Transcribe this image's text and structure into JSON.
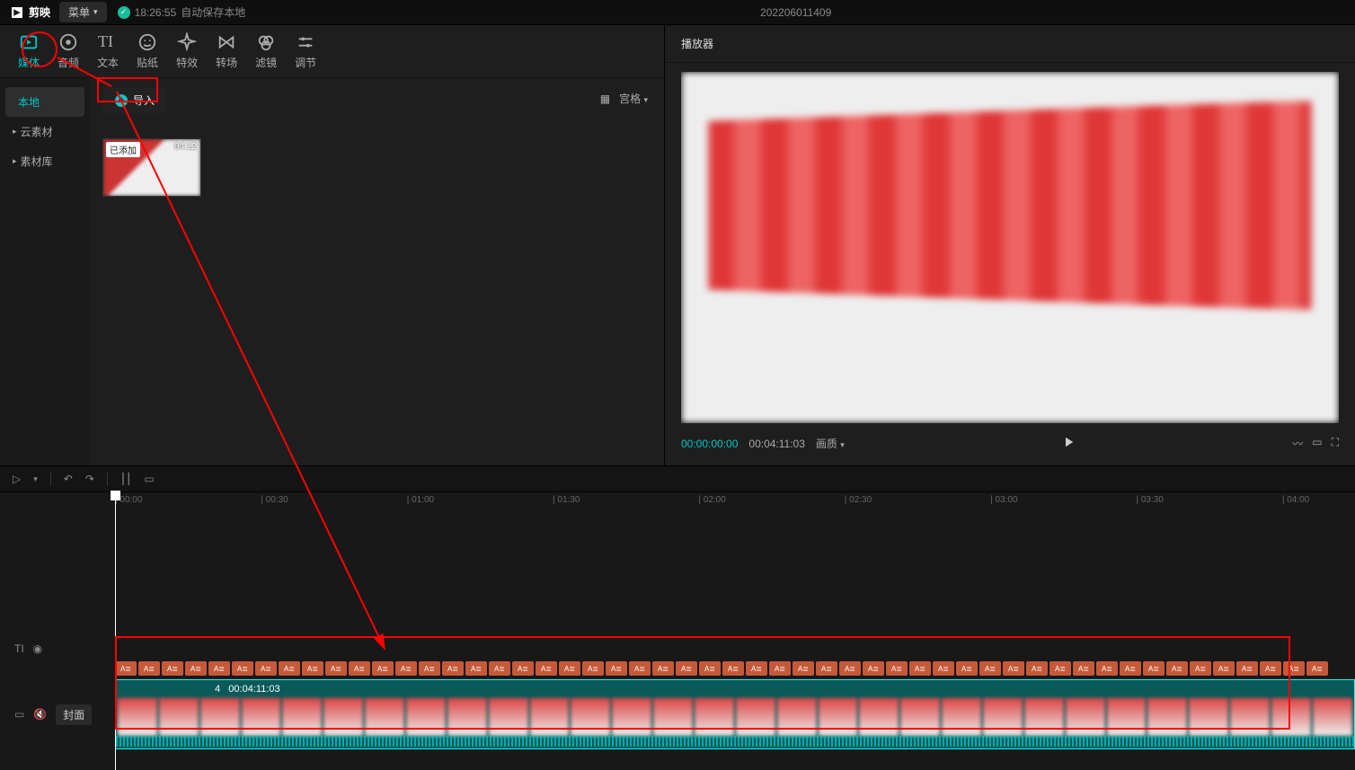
{
  "titlebar": {
    "app_name": "剪映",
    "menu_label": "菜单",
    "autosave_time": "18:26:55",
    "autosave_label": "自动保存本地",
    "project_title": "202206011409"
  },
  "category_tabs": [
    {
      "key": "media",
      "label": "媒体",
      "active": true
    },
    {
      "key": "audio",
      "label": "音频",
      "active": false
    },
    {
      "key": "text",
      "label": "文本",
      "active": false
    },
    {
      "key": "sticker",
      "label": "贴纸",
      "active": false
    },
    {
      "key": "effect",
      "label": "特效",
      "active": false
    },
    {
      "key": "trans",
      "label": "转场",
      "active": false
    },
    {
      "key": "filter",
      "label": "滤镜",
      "active": false
    },
    {
      "key": "adjust",
      "label": "调节",
      "active": false
    }
  ],
  "sidebar": {
    "items": [
      {
        "label": "本地",
        "active": true,
        "expandable": false
      },
      {
        "label": "云素材",
        "active": false,
        "expandable": true
      },
      {
        "label": "素材库",
        "active": false,
        "expandable": true
      }
    ]
  },
  "content": {
    "import_label": "导入",
    "layout_label": "宫格",
    "media": [
      {
        "badge": "已添加",
        "duration": "04:12"
      }
    ]
  },
  "player": {
    "title": "播放器",
    "tc_current": "00:00:00:00",
    "tc_total": "00:04:11:03",
    "quality_label": "画质"
  },
  "timeline": {
    "ticks": [
      "00:00",
      "00:30",
      "01:00",
      "01:30",
      "02:00",
      "02:30",
      "03:00",
      "03:30",
      "04:00"
    ],
    "cover_label": "封面",
    "clip_index": "4",
    "clip_duration": "00:04:11:03",
    "marker_glyph": "A≣",
    "marker_count": 52,
    "thumb_count": 30
  }
}
